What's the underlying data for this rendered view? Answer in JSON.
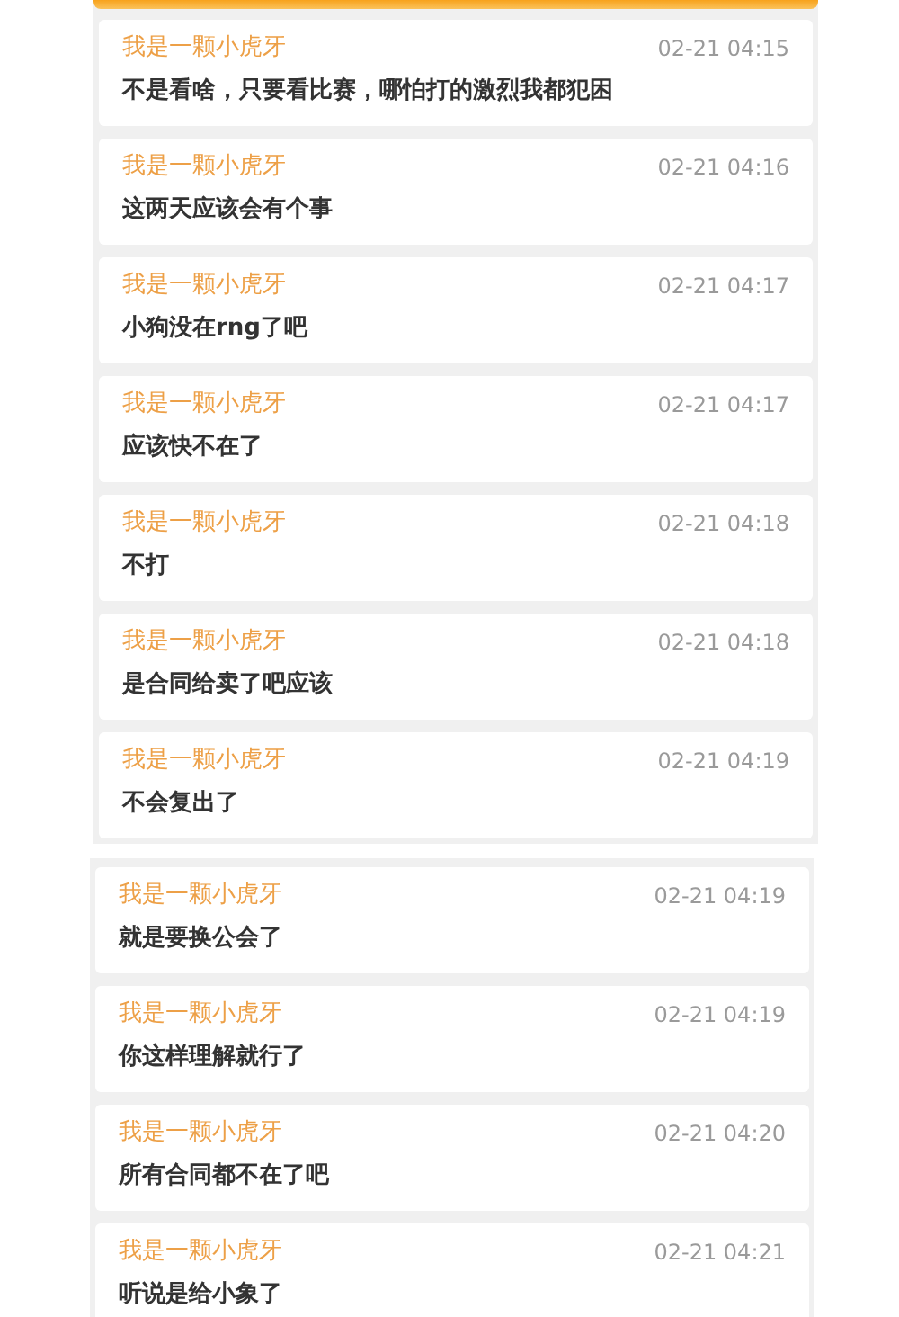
{
  "panels": [
    {
      "messages": [
        {
          "user": "我是一颗小虎牙",
          "time": "02-21 04:15",
          "text": "不是看啥，只要看比赛，哪怕打的激烈我都犯困"
        },
        {
          "user": "我是一颗小虎牙",
          "time": "02-21 04:16",
          "text": "这两天应该会有个事"
        },
        {
          "user": "我是一颗小虎牙",
          "time": "02-21 04:17",
          "text": "小狗没在rng了吧"
        },
        {
          "user": "我是一颗小虎牙",
          "time": "02-21 04:17",
          "text": "应该快不在了"
        },
        {
          "user": "我是一颗小虎牙",
          "time": "02-21 04:18",
          "text": "不打"
        },
        {
          "user": "我是一颗小虎牙",
          "time": "02-21 04:18",
          "text": "是合同给卖了吧应该"
        },
        {
          "user": "我是一颗小虎牙",
          "time": "02-21 04:19",
          "text": "不会复出了"
        }
      ]
    },
    {
      "messages": [
        {
          "user": "我是一颗小虎牙",
          "time": "02-21 04:19",
          "text": "就是要换公会了"
        },
        {
          "user": "我是一颗小虎牙",
          "time": "02-21 04:19",
          "text": "你这样理解就行了"
        },
        {
          "user": "我是一颗小虎牙",
          "time": "02-21 04:20",
          "text": "所有合同都不在了吧"
        },
        {
          "user": "我是一颗小虎牙",
          "time": "02-21 04:21",
          "text": "听说是给小象了"
        }
      ]
    }
  ]
}
